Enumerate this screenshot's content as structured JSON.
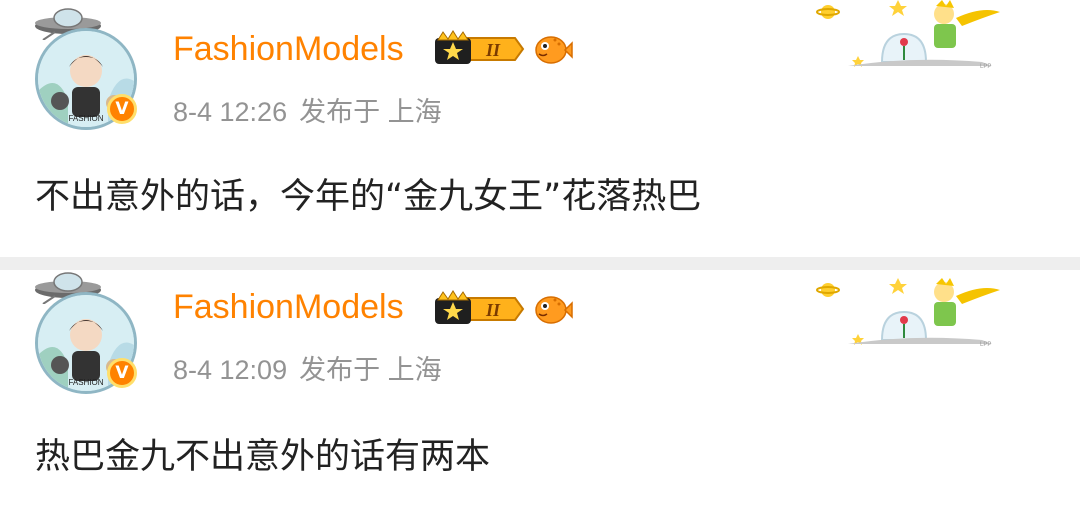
{
  "posts": [
    {
      "username": "FashionModels",
      "level_badge": "II",
      "verified_mark": "V",
      "date": "8-4 12:26",
      "location": "发布于 上海",
      "content": "不出意外的话，今年的“金九女王”花落热巴"
    },
    {
      "username": "FashionModels",
      "level_badge": "II",
      "verified_mark": "V",
      "date": "8-4 12:09",
      "location": "发布于 上海",
      "content": "热巴金九不出意外的话有两本"
    }
  ],
  "colors": {
    "accent": "#ff8200",
    "meta_text": "#939393",
    "body_text": "#222222",
    "separator": "#eeeeee"
  },
  "icons": [
    "ufo-icon",
    "crown-level-badge-icon",
    "pufferfish-icon",
    "verified-icon",
    "little-prince-decoration"
  ]
}
